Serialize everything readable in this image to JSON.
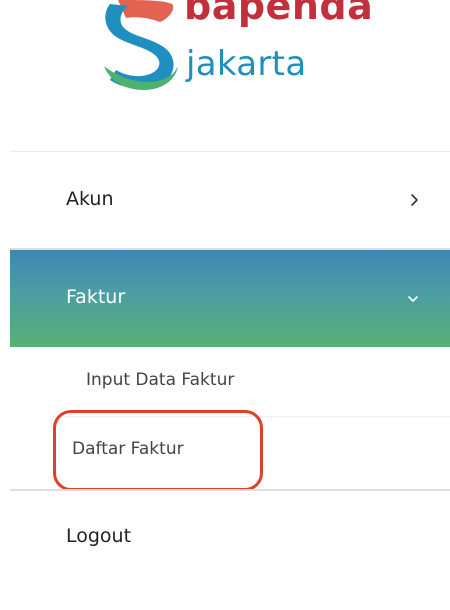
{
  "brand": {
    "name_top": "bapenda",
    "name_bottom": "jakarta",
    "color_top": "#c0313d",
    "color_bottom": "#1f8fbf",
    "logo_icon": "bapenda-s-logo-icon"
  },
  "menu": {
    "items": [
      {
        "label": "Akun",
        "icon": "chevron-right-icon"
      },
      {
        "label": "Faktur",
        "icon": "chevron-down-icon",
        "active": true
      },
      {
        "label": "Logout"
      }
    ],
    "submenu": [
      {
        "label": "Input Data Faktur"
      },
      {
        "label": "Daftar Faktur",
        "highlighted": true
      }
    ],
    "active_gradient": [
      "#3d86b4",
      "#55ad74"
    ],
    "highlight_color": "#e0402b"
  }
}
